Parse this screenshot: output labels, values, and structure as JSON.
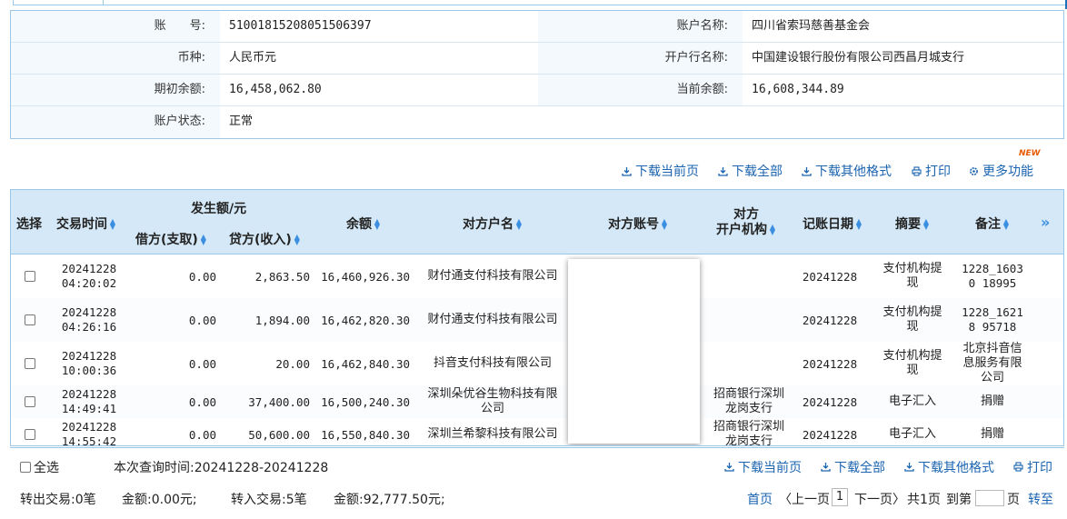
{
  "account": {
    "number_label": "账　　号:",
    "number": "51001815208051506397",
    "name_label": "账户名称:",
    "name": "四川省索玛慈善基金会",
    "currency_label": "币种:",
    "currency": "人民币元",
    "bank_label": "开户行名称:",
    "bank": "中国建设银行股份有限公司西昌月城支行",
    "opening_balance_label": "期初余额:",
    "opening_balance": "16,458,062.80",
    "current_balance_label": "当前余额:",
    "current_balance": "16,608,344.89",
    "status_label": "账户状态:",
    "status": "正常"
  },
  "toolbar": {
    "download_current": "下载当前页",
    "download_all": "下载全部",
    "download_other": "下载其他格式",
    "print": "打印",
    "more": "更多功能",
    "new_badge": "NEW"
  },
  "table": {
    "headers": {
      "select": "选择",
      "time": "交易时间",
      "amount_group": "发生额/元",
      "debit": "借方(支取)",
      "credit": "贷方(收入)",
      "balance": "余额",
      "counterparty_name": "对方户名",
      "counterparty_account": "对方账号",
      "counterparty_bank_line1": "对方",
      "counterparty_bank_line2": "开户机构",
      "post_date": "记账日期",
      "summary": "摘要",
      "remark": "备注",
      "expand": "»"
    },
    "rows": [
      {
        "date": "20241228",
        "time": "04:20:02",
        "debit": "0.00",
        "credit": "2,863.50",
        "balance": "16,460,926.30",
        "name": "财付通支付科技有限公司",
        "bank": "",
        "post_date": "20241228",
        "summary": "支付机构提现",
        "remark": "1228_16030 18995"
      },
      {
        "date": "20241228",
        "time": "04:26:16",
        "debit": "0.00",
        "credit": "1,894.00",
        "balance": "16,462,820.30",
        "name": "财付通支付科技有限公司",
        "bank": "",
        "post_date": "20241228",
        "summary": "支付机构提现",
        "remark": "1228_16218 95718"
      },
      {
        "date": "20241228",
        "time": "10:00:36",
        "debit": "0.00",
        "credit": "20.00",
        "balance": "16,462,840.30",
        "name": "抖音支付科技有限公司",
        "bank": "",
        "post_date": "20241228",
        "summary": "支付机构提现",
        "remark": "北京抖音信息服务有限公司"
      },
      {
        "date": "20241228",
        "time": "14:49:41",
        "debit": "0.00",
        "credit": "37,400.00",
        "balance": "16,500,240.30",
        "name": "深圳朵优谷生物科技有限公司",
        "bank": "招商银行深圳龙岗支行",
        "post_date": "20241228",
        "summary": "电子汇入",
        "remark": "捐赠"
      },
      {
        "date": "20241228",
        "time": "14:55:42",
        "debit": "0.00",
        "credit": "50,600.00",
        "balance": "16,550,840.30",
        "name": "深圳兰希黎科技有限公司",
        "bank": "招商银行深圳龙岗支行",
        "post_date": "20241228",
        "summary": "电子汇入",
        "remark": "捐赠"
      }
    ]
  },
  "footer": {
    "select_all": "全选",
    "query_time": "本次查询时间:20241228-20241228",
    "download_current": "下载当前页",
    "download_all": "下载全部",
    "download_other": "下载其他格式",
    "print": "打印",
    "out_count": "转出交易:0笔",
    "out_amount": "金额:0.00元;",
    "in_count": "转入交易:5笔",
    "in_amount": "金额:92,777.50元;",
    "first_page": "首页",
    "prev_page": "〈上一页",
    "current_page": "1",
    "next_page": "下一页〉",
    "total_pages": "共1页",
    "goto_label": "到第",
    "goto_suffix": "页",
    "goto_button": "转至"
  }
}
